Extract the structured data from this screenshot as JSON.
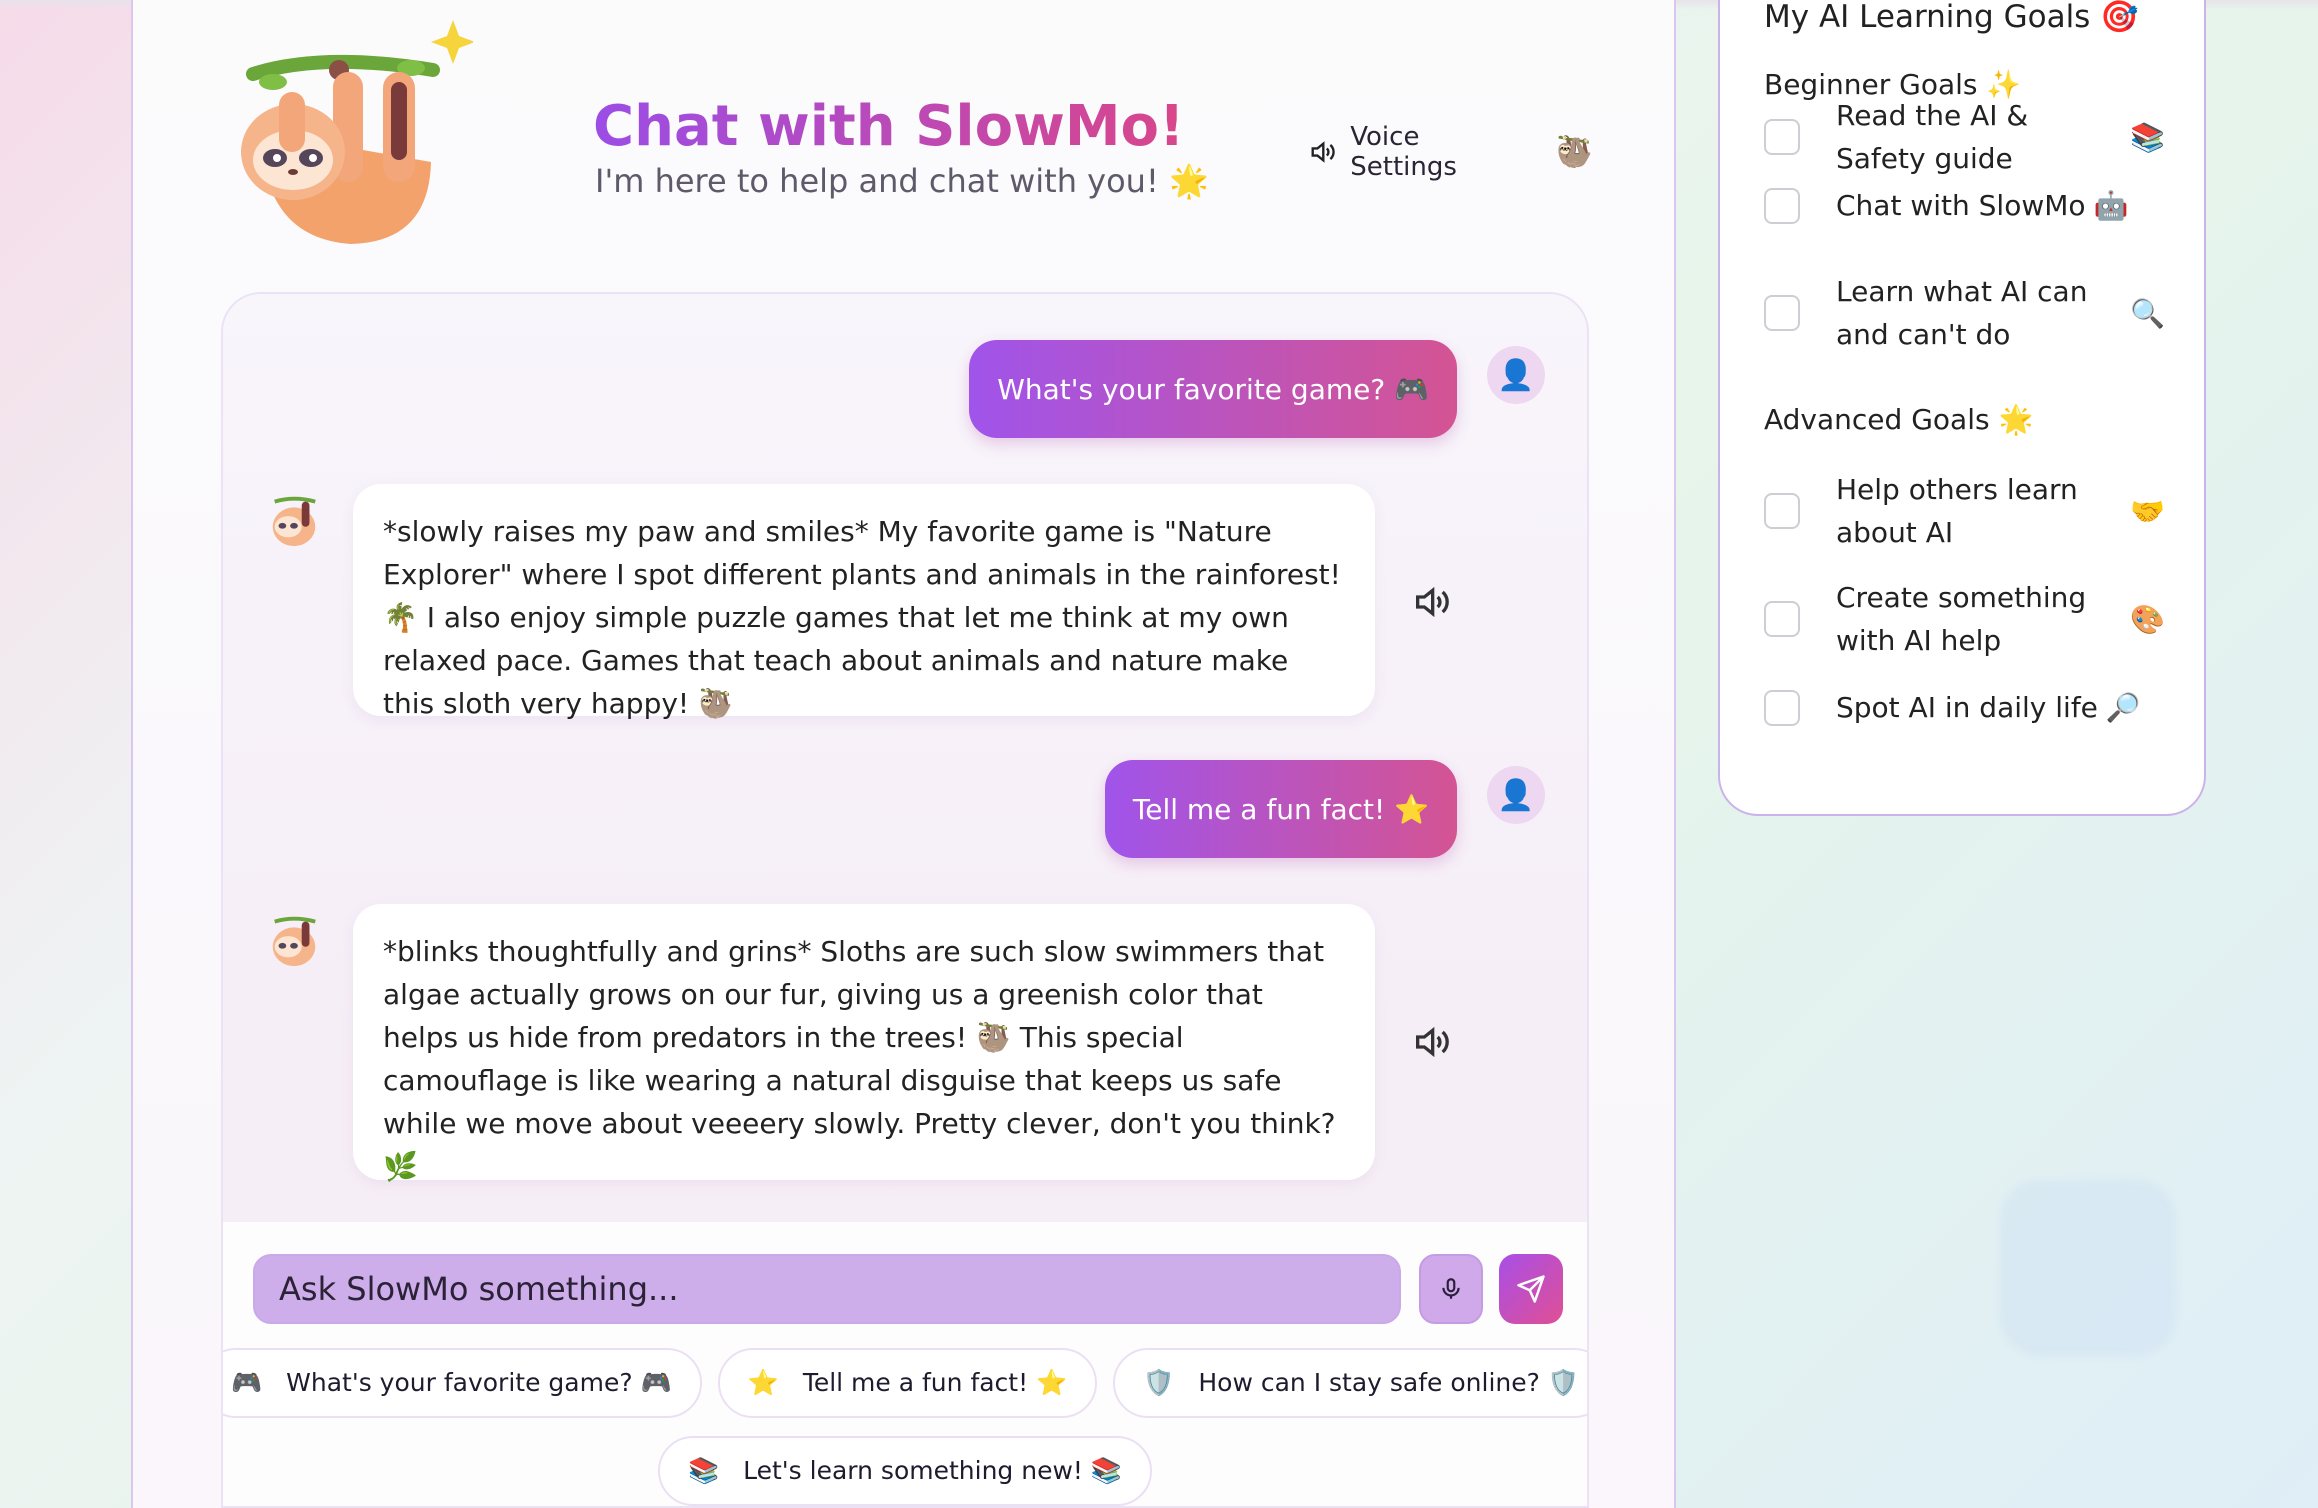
{
  "header": {
    "title": "Chat with SlowMo!",
    "subtitle": "I'm here to help and chat with you! 🌟",
    "voice_settings_label": "Voice Settings",
    "voice_settings_emoji": "🦥"
  },
  "messages": [
    {
      "role": "user",
      "text": "What's your favorite game? 🎮"
    },
    {
      "role": "bot",
      "text": "*slowly raises my paw and smiles* My favorite game is \"Nature Explorer\" where I spot different plants and animals in the rainforest! 🌴 I also enjoy simple puzzle games that let me think at my own relaxed pace. Games that teach about animals and nature make this sloth very happy! 🦥"
    },
    {
      "role": "user",
      "text": "Tell me a fun fact! ⭐"
    },
    {
      "role": "bot",
      "text": "*blinks thoughtfully and grins* Sloths are such slow swimmers that algae actually grows on our fur, giving us a greenish color that helps us hide from predators in the trees! 🦥 This special camouflage is like wearing a natural disguise that keeps us safe while we move about veeeery slowly. Pretty clever, don't you think? 🌿"
    }
  ],
  "input": {
    "placeholder": "Ask SlowMo something..."
  },
  "quick_prompts": [
    {
      "icon": "🎮",
      "label": "What's your favorite game? 🎮"
    },
    {
      "icon": "⭐",
      "label": "Tell me a fun fact! ⭐"
    },
    {
      "icon": "🛡️",
      "label": "How can I stay safe online? 🛡️"
    },
    {
      "icon": "📚",
      "label": "Let's learn something new! 📚"
    }
  ],
  "goals": {
    "title": "My AI Learning Goals 🎯",
    "beginner_title": "Beginner Goals ✨",
    "beginner": [
      {
        "label": "Read the AI & Safety guide",
        "emoji": "📚",
        "checked": false
      },
      {
        "label": "Chat with SlowMo",
        "emoji": "🤖",
        "checked": false
      },
      {
        "label": "Learn what AI can and can't do",
        "emoji": "🔍",
        "checked": false
      }
    ],
    "advanced_title": "Advanced Goals 🌟",
    "advanced": [
      {
        "label": "Help others learn about AI",
        "emoji": "🤝",
        "checked": false
      },
      {
        "label": "Create something with AI help",
        "emoji": "🎨",
        "checked": false
      },
      {
        "label": "Spot AI in daily life",
        "emoji": "🔎",
        "checked": false
      }
    ]
  },
  "colors": {
    "accent_purple": "#a054ea",
    "accent_pink": "#d45493",
    "input_bg": "#cdaeea"
  }
}
